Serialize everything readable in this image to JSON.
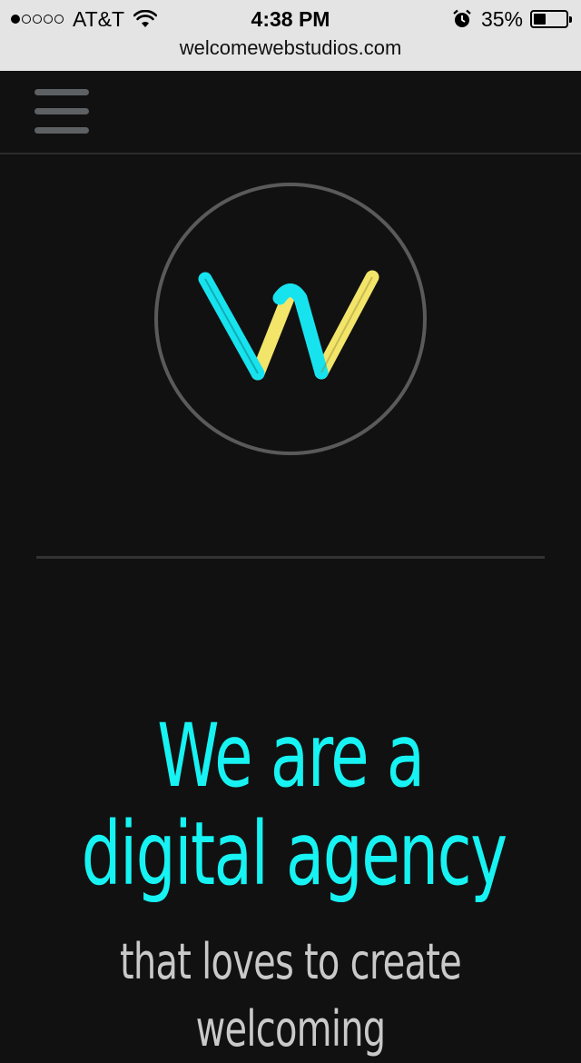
{
  "status_bar": {
    "carrier": "AT&T",
    "signal_bars_filled": 1,
    "signal_bars_total": 5,
    "time": "4:38 PM",
    "battery_percent": "35%",
    "url": "welcomewebstudios.com"
  },
  "nav": {
    "menu_icon": "hamburger-menu-icon"
  },
  "logo": {
    "icon": "w-logo-icon",
    "colors": {
      "primary": "#17e3ef",
      "secondary": "#f3e56a",
      "ring": "#5a5a5a"
    }
  },
  "hero": {
    "headline_line1": "We are a",
    "headline_line2": "digital agency",
    "subhead_line1": "that loves to create",
    "subhead_line2": "welcoming",
    "colors": {
      "headline": "#17f2f2",
      "subhead": "#c9c9c9",
      "background": "#111111"
    }
  }
}
